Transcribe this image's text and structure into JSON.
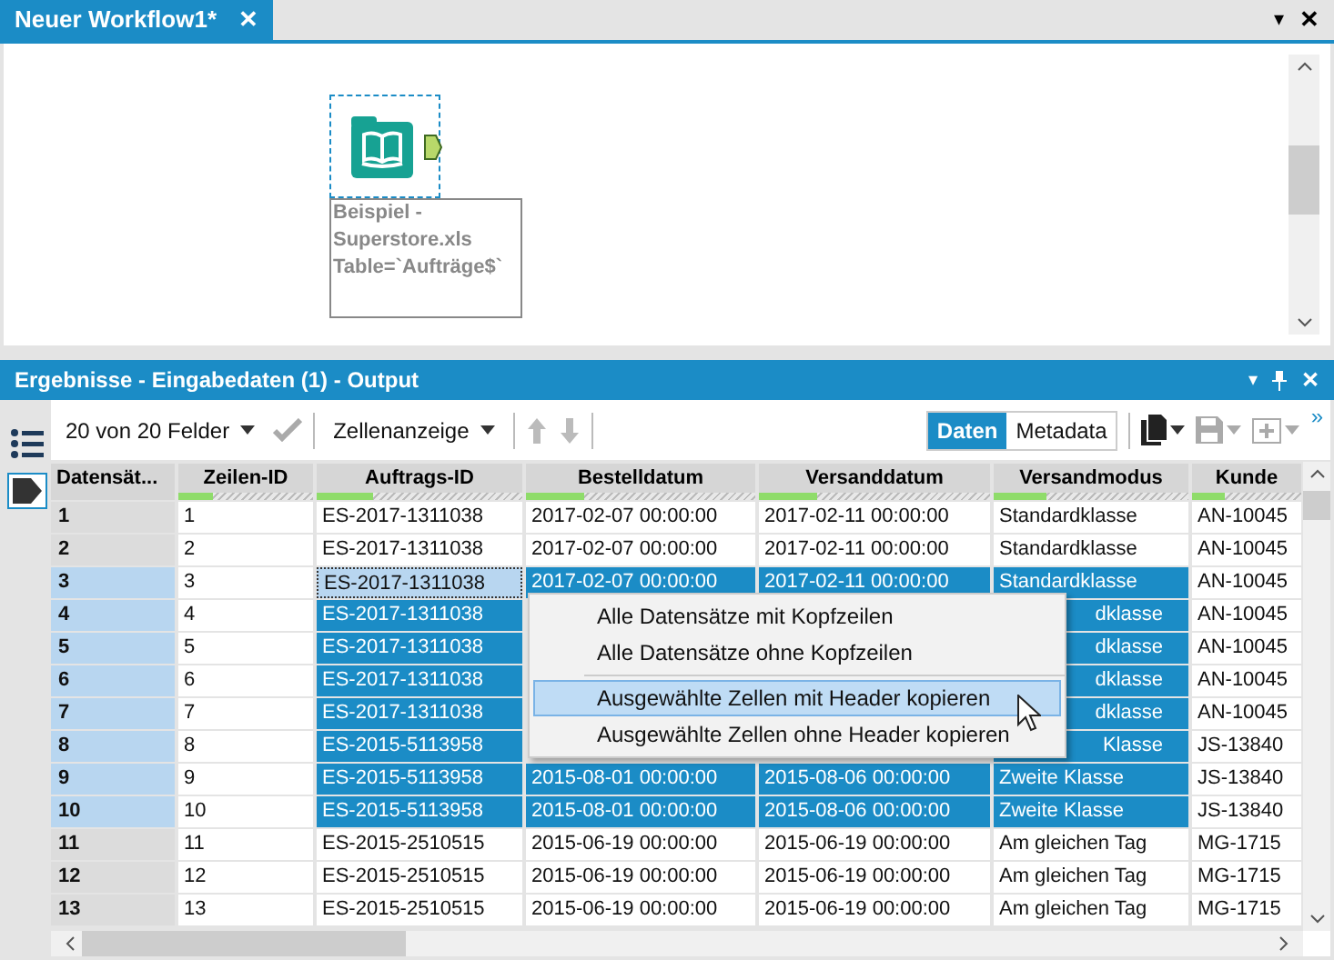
{
  "tab": {
    "title": "Neuer Workflow1*",
    "close": "✕"
  },
  "window_controls": {
    "menu": "▾",
    "close": "✕"
  },
  "canvas": {
    "node": {
      "label": "Beispiel - Superstore.xls Table=`Aufträge$`",
      "selected": true
    }
  },
  "results": {
    "title": "Ergebnisse - Eingabedaten (1) - Output",
    "header_icons": [
      "▾",
      "✕"
    ]
  },
  "toolbar": {
    "fields": "20 von 20 Felder",
    "view": "Zellenanzeige",
    "toggle": [
      {
        "label": "Daten",
        "selected": true
      },
      {
        "label": "Metadata",
        "selected": false
      }
    ],
    "more": "»"
  },
  "table": {
    "columns": [
      {
        "label": "Datensät..."
      },
      {
        "label": "Zeilen-ID",
        "level": 0.25
      },
      {
        "label": "Auftrags-ID",
        "level": 0.27
      },
      {
        "label": "Bestelldatum",
        "level": 0.25
      },
      {
        "label": "Versanddatum",
        "level": 0.25
      },
      {
        "label": "Versandmodus",
        "level": 0.27
      },
      {
        "label": "Kunde",
        "level": 0.3
      }
    ],
    "rows": [
      {
        "selected": false,
        "cells": [
          {
            "text": "1"
          },
          {
            "text": "1"
          },
          {
            "text": "ES-2017-1311038"
          },
          {
            "text": "2017-02-07 00:00:00"
          },
          {
            "text": "2017-02-11 00:00:00"
          },
          {
            "text": "Standardklasse"
          },
          {
            "text": "AN-10045"
          }
        ]
      },
      {
        "selected": false,
        "cells": [
          {
            "text": "2"
          },
          {
            "text": "2"
          },
          {
            "text": "ES-2017-1311038"
          },
          {
            "text": "2017-02-07 00:00:00"
          },
          {
            "text": "2017-02-11 00:00:00"
          },
          {
            "text": "Standardklasse"
          },
          {
            "text": "AN-10045"
          }
        ]
      },
      {
        "selected": true,
        "cells": [
          {
            "text": "3"
          },
          {
            "text": "3"
          },
          {
            "text": "ES-2017-1311038",
            "focused": true
          },
          {
            "text": "2017-02-07 00:00:00",
            "selected": true
          },
          {
            "text": "2017-02-11 00:00:00",
            "selected": true
          },
          {
            "text": "Standardklasse",
            "selected": true
          },
          {
            "text": "AN-10045"
          }
        ]
      },
      {
        "selected": true,
        "cells": [
          {
            "text": "4"
          },
          {
            "text": "4"
          },
          {
            "text": "ES-2017-1311038",
            "selected": true
          },
          null,
          null,
          {
            "text": "dklasse",
            "selected": true,
            "covered": true
          },
          {
            "text": "AN-10045"
          }
        ]
      },
      {
        "selected": true,
        "cells": [
          {
            "text": "5"
          },
          {
            "text": "5"
          },
          {
            "text": "ES-2017-1311038",
            "selected": true
          },
          null,
          null,
          {
            "text": "dklasse",
            "selected": true,
            "covered": true
          },
          {
            "text": "AN-10045"
          }
        ]
      },
      {
        "selected": true,
        "cells": [
          {
            "text": "6"
          },
          {
            "text": "6"
          },
          {
            "text": "ES-2017-1311038",
            "selected": true
          },
          null,
          null,
          {
            "text": "dklasse",
            "selected": true,
            "covered": true
          },
          {
            "text": "AN-10045"
          }
        ]
      },
      {
        "selected": true,
        "cells": [
          {
            "text": "7"
          },
          {
            "text": "7"
          },
          {
            "text": "ES-2017-1311038",
            "selected": true
          },
          null,
          null,
          {
            "text": "dklasse",
            "selected": true,
            "covered": true
          },
          {
            "text": "AN-10045"
          }
        ]
      },
      {
        "selected": true,
        "cells": [
          {
            "text": "8"
          },
          {
            "text": "8"
          },
          {
            "text": "ES-2015-5113958",
            "selected": true
          },
          null,
          null,
          {
            "text": "Klasse",
            "selected": true,
            "covered": true
          },
          {
            "text": "JS-13840"
          }
        ]
      },
      {
        "selected": true,
        "cells": [
          {
            "text": "9"
          },
          {
            "text": "9"
          },
          {
            "text": "ES-2015-5113958",
            "selected": true
          },
          {
            "text": "2015-08-01 00:00:00",
            "selected": true
          },
          {
            "text": "2015-08-06 00:00:00",
            "selected": true
          },
          {
            "text": "Zweite Klasse",
            "selected": true
          },
          {
            "text": "JS-13840"
          }
        ]
      },
      {
        "selected": true,
        "cells": [
          {
            "text": "10"
          },
          {
            "text": "10"
          },
          {
            "text": "ES-2015-5113958",
            "selected": true
          },
          {
            "text": "2015-08-01 00:00:00",
            "selected": true
          },
          {
            "text": "2015-08-06 00:00:00",
            "selected": true
          },
          {
            "text": "Zweite Klasse",
            "selected": true
          },
          {
            "text": "JS-13840"
          }
        ]
      },
      {
        "selected": false,
        "cells": [
          {
            "text": "11"
          },
          {
            "text": "11"
          },
          {
            "text": "ES-2015-2510515"
          },
          {
            "text": "2015-06-19 00:00:00"
          },
          {
            "text": "2015-06-19 00:00:00"
          },
          {
            "text": "Am gleichen Tag"
          },
          {
            "text": "MG-1715"
          }
        ]
      },
      {
        "selected": false,
        "cells": [
          {
            "text": "12"
          },
          {
            "text": "12"
          },
          {
            "text": "ES-2015-2510515"
          },
          {
            "text": "2015-06-19 00:00:00"
          },
          {
            "text": "2015-06-19 00:00:00"
          },
          {
            "text": "Am gleichen Tag"
          },
          {
            "text": "MG-1715"
          }
        ]
      },
      {
        "selected": false,
        "cells": [
          {
            "text": "13"
          },
          {
            "text": "13"
          },
          {
            "text": "ES-2015-2510515"
          },
          {
            "text": "2015-06-19 00:00:00"
          },
          {
            "text": "2015-06-19 00:00:00"
          },
          {
            "text": "Am gleichen Tag"
          },
          {
            "text": "MG-1715"
          }
        ]
      }
    ]
  },
  "context_menu": {
    "groups": [
      [
        {
          "label": "Alle Datensätze mit Kopfzeilen",
          "selected": false
        },
        {
          "label": "Alle Datensätze ohne Kopfzeilen",
          "selected": false
        }
      ],
      [
        {
          "label": "Ausgewählte Zellen mit Header kopieren",
          "selected": true
        },
        {
          "label": "Ausgewählte Zellen ohne Header kopieren",
          "selected": false
        }
      ]
    ]
  }
}
